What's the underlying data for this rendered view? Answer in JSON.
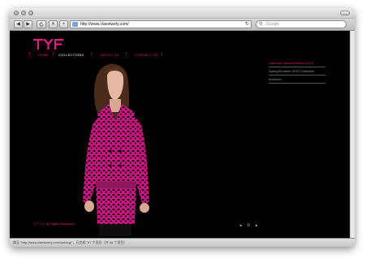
{
  "browser": {
    "back_label": "◀",
    "forward_label": "▶",
    "stop_label": "✕",
    "add_label": "+",
    "url": "http://www.claestwety.com/",
    "search_placeholder": "Google"
  },
  "site": {
    "logo_text": "TYF",
    "nav": [
      {
        "label": "Home"
      },
      {
        "label": "Collections"
      },
      {
        "label": "About us"
      },
      {
        "label": "Contact us"
      }
    ],
    "collections": [
      {
        "label": "Collection Autumn/Winter 2010"
      },
      {
        "label": "Spring/Summer 2010 Collection"
      },
      {
        "label": "Archives"
      }
    ],
    "copyright": "© T Y F All Rights Reserved",
    "pager": {
      "prev": "◂",
      "pause": "II",
      "next": "▸"
    }
  },
  "status": {
    "text": "跳至 \"http://www.claestwety.com/weblog/\"，已完成 \"67 个项目（共 68 个项目）"
  },
  "colors": {
    "accent": "#e8198b",
    "background": "#000000",
    "nav_active": "#ffffff"
  }
}
